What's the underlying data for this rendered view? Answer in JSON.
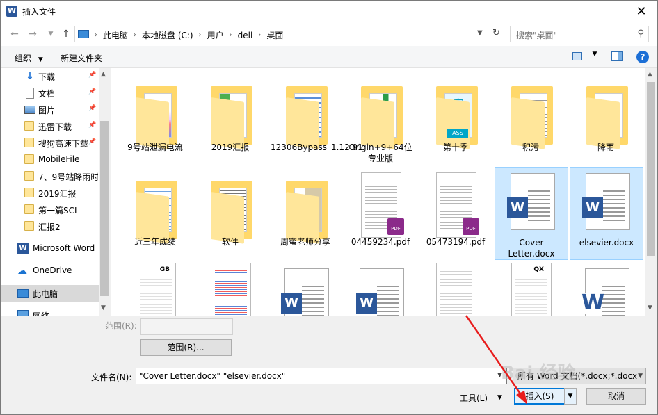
{
  "window": {
    "title": "插入文件",
    "app_icon": "W",
    "close_glyph": "✕"
  },
  "address": {
    "crumbs": [
      "此电脑",
      "本地磁盘 (C:)",
      "用户",
      "dell",
      "桌面"
    ],
    "search_placeholder": "搜索\"桌面\""
  },
  "toolbar": {
    "organize": "组织",
    "new_folder": "新建文件夹"
  },
  "sidebar": {
    "items": [
      {
        "label": "下载",
        "icon": "download-icon",
        "pinned": true
      },
      {
        "label": "文档",
        "icon": "document-icon",
        "pinned": true
      },
      {
        "label": "图片",
        "icon": "picture-icon",
        "pinned": true
      },
      {
        "label": "迅雷下载",
        "icon": "folder-icon",
        "pinned": true
      },
      {
        "label": "搜狗高速下载",
        "icon": "folder-icon",
        "pinned": true
      },
      {
        "label": "MobileFile",
        "icon": "folder-icon",
        "pinned": false
      },
      {
        "label": "7、9号站降雨时",
        "icon": "folder-icon",
        "pinned": false
      },
      {
        "label": "2019汇报",
        "icon": "folder-icon",
        "pinned": false
      },
      {
        "label": "第一篇SCI",
        "icon": "folder-icon",
        "pinned": false
      },
      {
        "label": "汇报2",
        "icon": "folder-icon",
        "pinned": false
      },
      {
        "label": "Microsoft Word",
        "icon": "word-icon",
        "pinned": false
      },
      {
        "label": "OneDrive",
        "icon": "cloud-icon",
        "pinned": false
      },
      {
        "label": "此电脑",
        "icon": "computer-icon",
        "pinned": false,
        "selected": true
      },
      {
        "label": "网络",
        "icon": "network-icon",
        "pinned": false
      }
    ]
  },
  "files": {
    "row1": [
      "9号站泄漏电流",
      "2019汇报",
      "12306Bypass_1.12.91",
      "Origin+9+64位专业版",
      "第十季",
      "积污",
      "降雨"
    ],
    "row2": [
      "近三年成绩",
      "软件",
      "周蜜老师分享",
      "04459234.pdf",
      "05473194.pdf",
      "Cover Letter.docx",
      "elsevier.docx"
    ],
    "folder_thumb_texts": {
      "fourth": "字",
      "fourth_bottom": "ASS",
      "seventh": "a"
    },
    "word_badge": "W",
    "pdf_badge": "PDF",
    "doc_header_codes": {
      "gb": "GB",
      "qx": "QX"
    }
  },
  "bottom": {
    "range_label": "范围(R):",
    "range_button": "范围(R)...",
    "filename_label": "文件名(N):",
    "filename_value": "\"Cover Letter.docx\" \"elsevier.docx\"",
    "filetype_value": "所有 Word 文档(*.docx;*.docx",
    "tools": "工具(L)",
    "insert": "插入(S)",
    "cancel": "取消"
  },
  "watermark": "Bai 经验"
}
